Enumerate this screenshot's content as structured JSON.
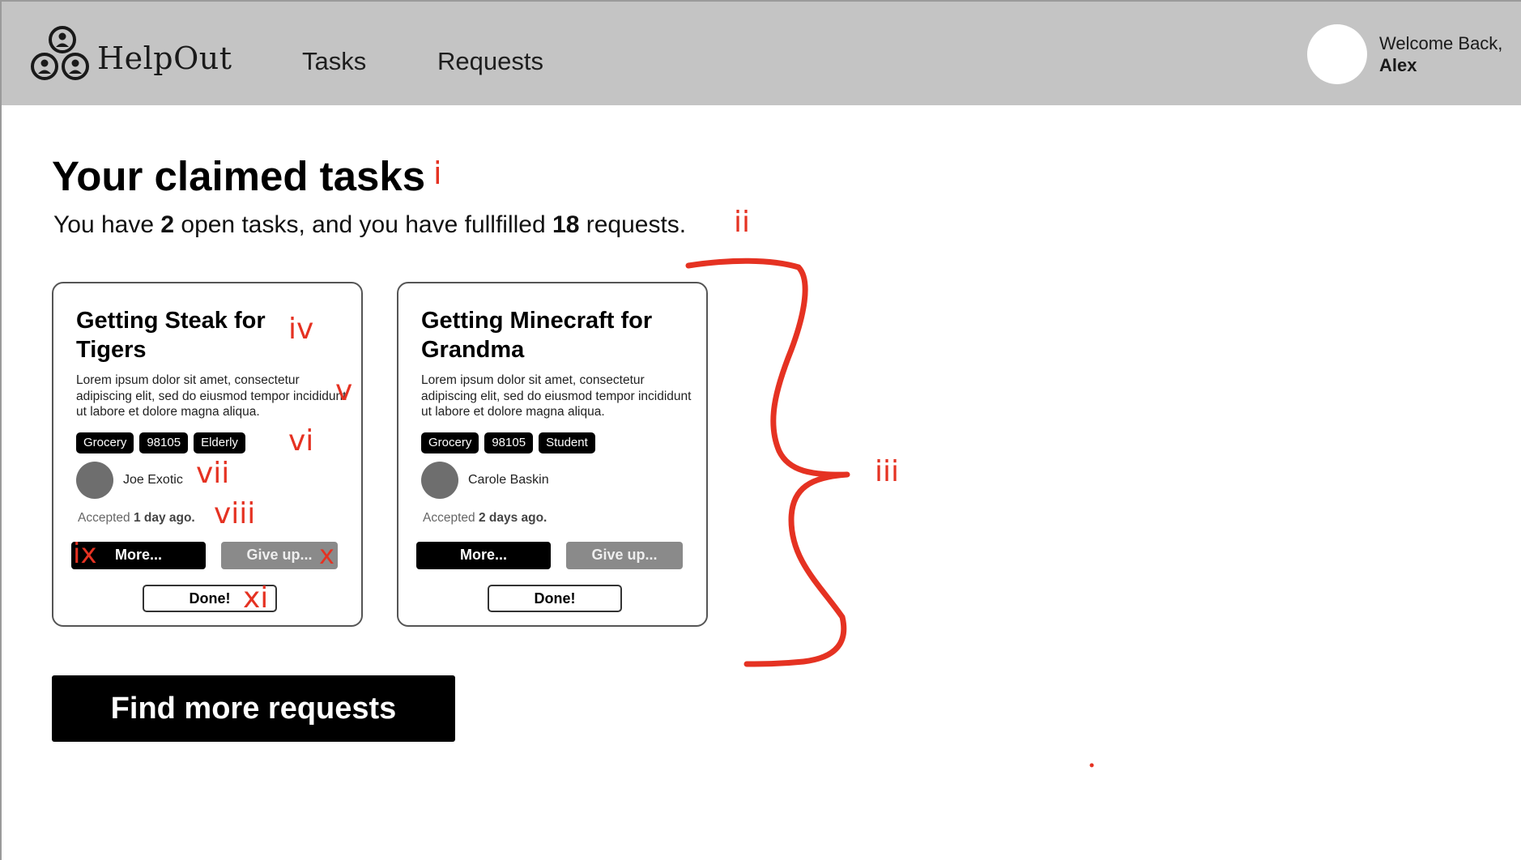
{
  "header": {
    "brand": "HelpOut",
    "nav": {
      "tasks": "Tasks",
      "requests": "Requests"
    },
    "welcome_line": "Welcome Back,",
    "user_name": "Alex"
  },
  "page": {
    "title": "Your claimed tasks",
    "summary": {
      "pre": "You have ",
      "open_count": "2",
      "mid": " open tasks, and you have fullfilled ",
      "fulfilled_count": "18",
      "post": " requests."
    }
  },
  "cards": [
    {
      "title": "Getting Steak for Tigers",
      "description": "Lorem ipsum dolor sit amet, consectetur adipiscing elit, sed do eiusmod tempor incididunt ut labore et dolore magna aliqua.",
      "tags": [
        "Grocery",
        "98105",
        "Elderly"
      ],
      "person": "Joe Exotic",
      "accepted_pre": "Accepted ",
      "accepted_time": "1 day ago.",
      "more_label": "More...",
      "giveup_label": "Give up...",
      "done_label": "Done!"
    },
    {
      "title": "Getting Minecraft for Grandma",
      "description": "Lorem ipsum dolor sit amet, consectetur adipiscing elit, sed do eiusmod tempor incididunt ut labore et dolore magna aliqua.",
      "tags": [
        "Grocery",
        "98105",
        "Student"
      ],
      "person": "Carole Baskin",
      "accepted_pre": "Accepted ",
      "accepted_time": "2 days ago.",
      "more_label": "More...",
      "giveup_label": "Give up...",
      "done_label": "Done!"
    }
  ],
  "find_more_label": "Find more requests",
  "annotations": {
    "i": "i",
    "ii": "ii",
    "iii": "iii",
    "iv": "iv",
    "v": "v",
    "vi": "vi",
    "vii": "vii",
    "viii": "viii",
    "ix": "ix",
    "x": "x",
    "xi": "xi"
  },
  "colors": {
    "header_bg": "#c4c4c4",
    "annotation_red": "#e53222",
    "button_dark": "#000000",
    "button_muted": "#8a8a8a"
  },
  "icons": {
    "logo": "three-people-logo-icon"
  }
}
